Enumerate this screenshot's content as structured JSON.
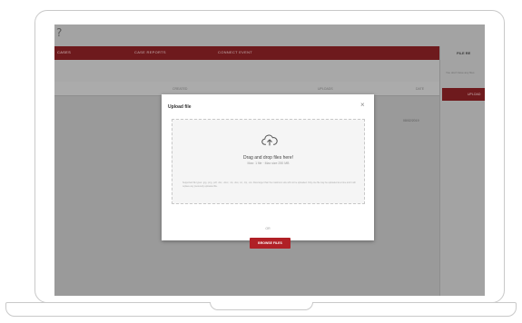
{
  "app": {
    "logo": "?",
    "nav": [
      "CASES",
      "CASE REPORTS",
      "CONNECT EVENT"
    ],
    "table_headers": [
      "CREATED",
      "UPLOADS",
      "DATE"
    ],
    "row_date": "08/02/2019"
  },
  "side_panel": {
    "title": "FILE RE",
    "text": "You don't have any files",
    "button": "UPLOAD"
  },
  "modal": {
    "title": "Upload file",
    "close_icon": "close-icon",
    "drop_title": "Drag and drop files here!",
    "drop_subtitle": "Max: 1 file · Max size 250 MB",
    "drop_note": "Supported file types: .jpg, .png, .pdf, .doc, .docx, .xls, .xlsx, .txt, .zip, .csv. Files larger than the maximum size will not be uploaded. Only one file may be uploaded at a time and it will replace any previously uploaded file.",
    "or_label": "OR",
    "browse_button": "BROWSE FILES",
    "upload_icon": "cloud-upload-icon"
  },
  "colors": {
    "brand_red": "#b02026",
    "dark_red_dimmed": "#6e1a1d",
    "overlay_gray": "#9a9a9a"
  }
}
